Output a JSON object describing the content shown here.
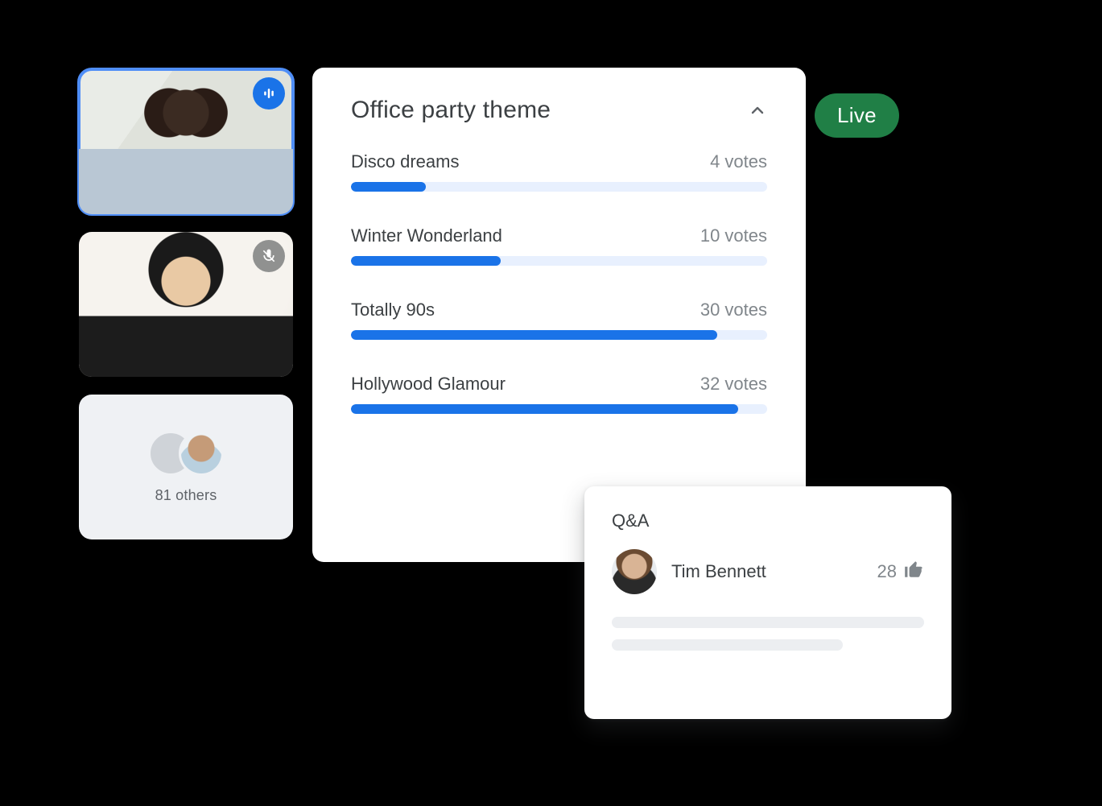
{
  "status": {
    "live_label": "Live"
  },
  "participants": {
    "tile1": {
      "speaking": true
    },
    "tile2": {
      "muted": true
    },
    "others_count_label": "81 others"
  },
  "poll": {
    "title": "Office party theme",
    "options": [
      {
        "label": "Disco dreams",
        "votes_label": "4 votes",
        "pct": 18
      },
      {
        "label": "Winter Wonderland",
        "votes_label": "10 votes",
        "pct": 36
      },
      {
        "label": "Totally 90s",
        "votes_label": "30 votes",
        "pct": 88
      },
      {
        "label": "Hollywood Glamour",
        "votes_label": "32 votes",
        "pct": 93
      }
    ]
  },
  "qa": {
    "title": "Q&A",
    "asker_name": "Tim Bennett",
    "upvotes": "28"
  },
  "chart_data": {
    "type": "bar",
    "title": "Office party theme",
    "categories": [
      "Disco dreams",
      "Winter Wonderland",
      "Totally 90s",
      "Hollywood Glamour"
    ],
    "values": [
      4,
      10,
      30,
      32
    ],
    "xlabel": "",
    "ylabel": "votes"
  }
}
